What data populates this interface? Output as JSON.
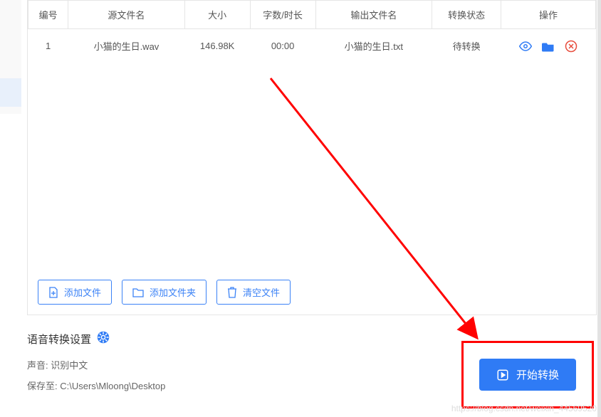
{
  "table": {
    "headers": [
      "编号",
      "源文件名",
      "大小",
      "字数/时长",
      "输出文件名",
      "转换状态",
      "操作"
    ],
    "rows": [
      {
        "index": "1",
        "source": "小猫的生日.wav",
        "size": "146.98K",
        "duration": "00:00",
        "output": "小猫的生日.txt",
        "status": "待转换"
      }
    ]
  },
  "toolbar": {
    "addFile": "添加文件",
    "addFolder": "添加文件夹",
    "clearFiles": "清空文件"
  },
  "settings": {
    "title": "语音转换设置",
    "voiceLabel": "声音",
    "voiceValue": "识别中文",
    "saveLabel": "保存至",
    "savePath": "C:\\Users\\Mloong\\Desktop"
  },
  "startButton": "开始转换",
  "watermark": "https://blog.csdn.net/weixin_44569520"
}
